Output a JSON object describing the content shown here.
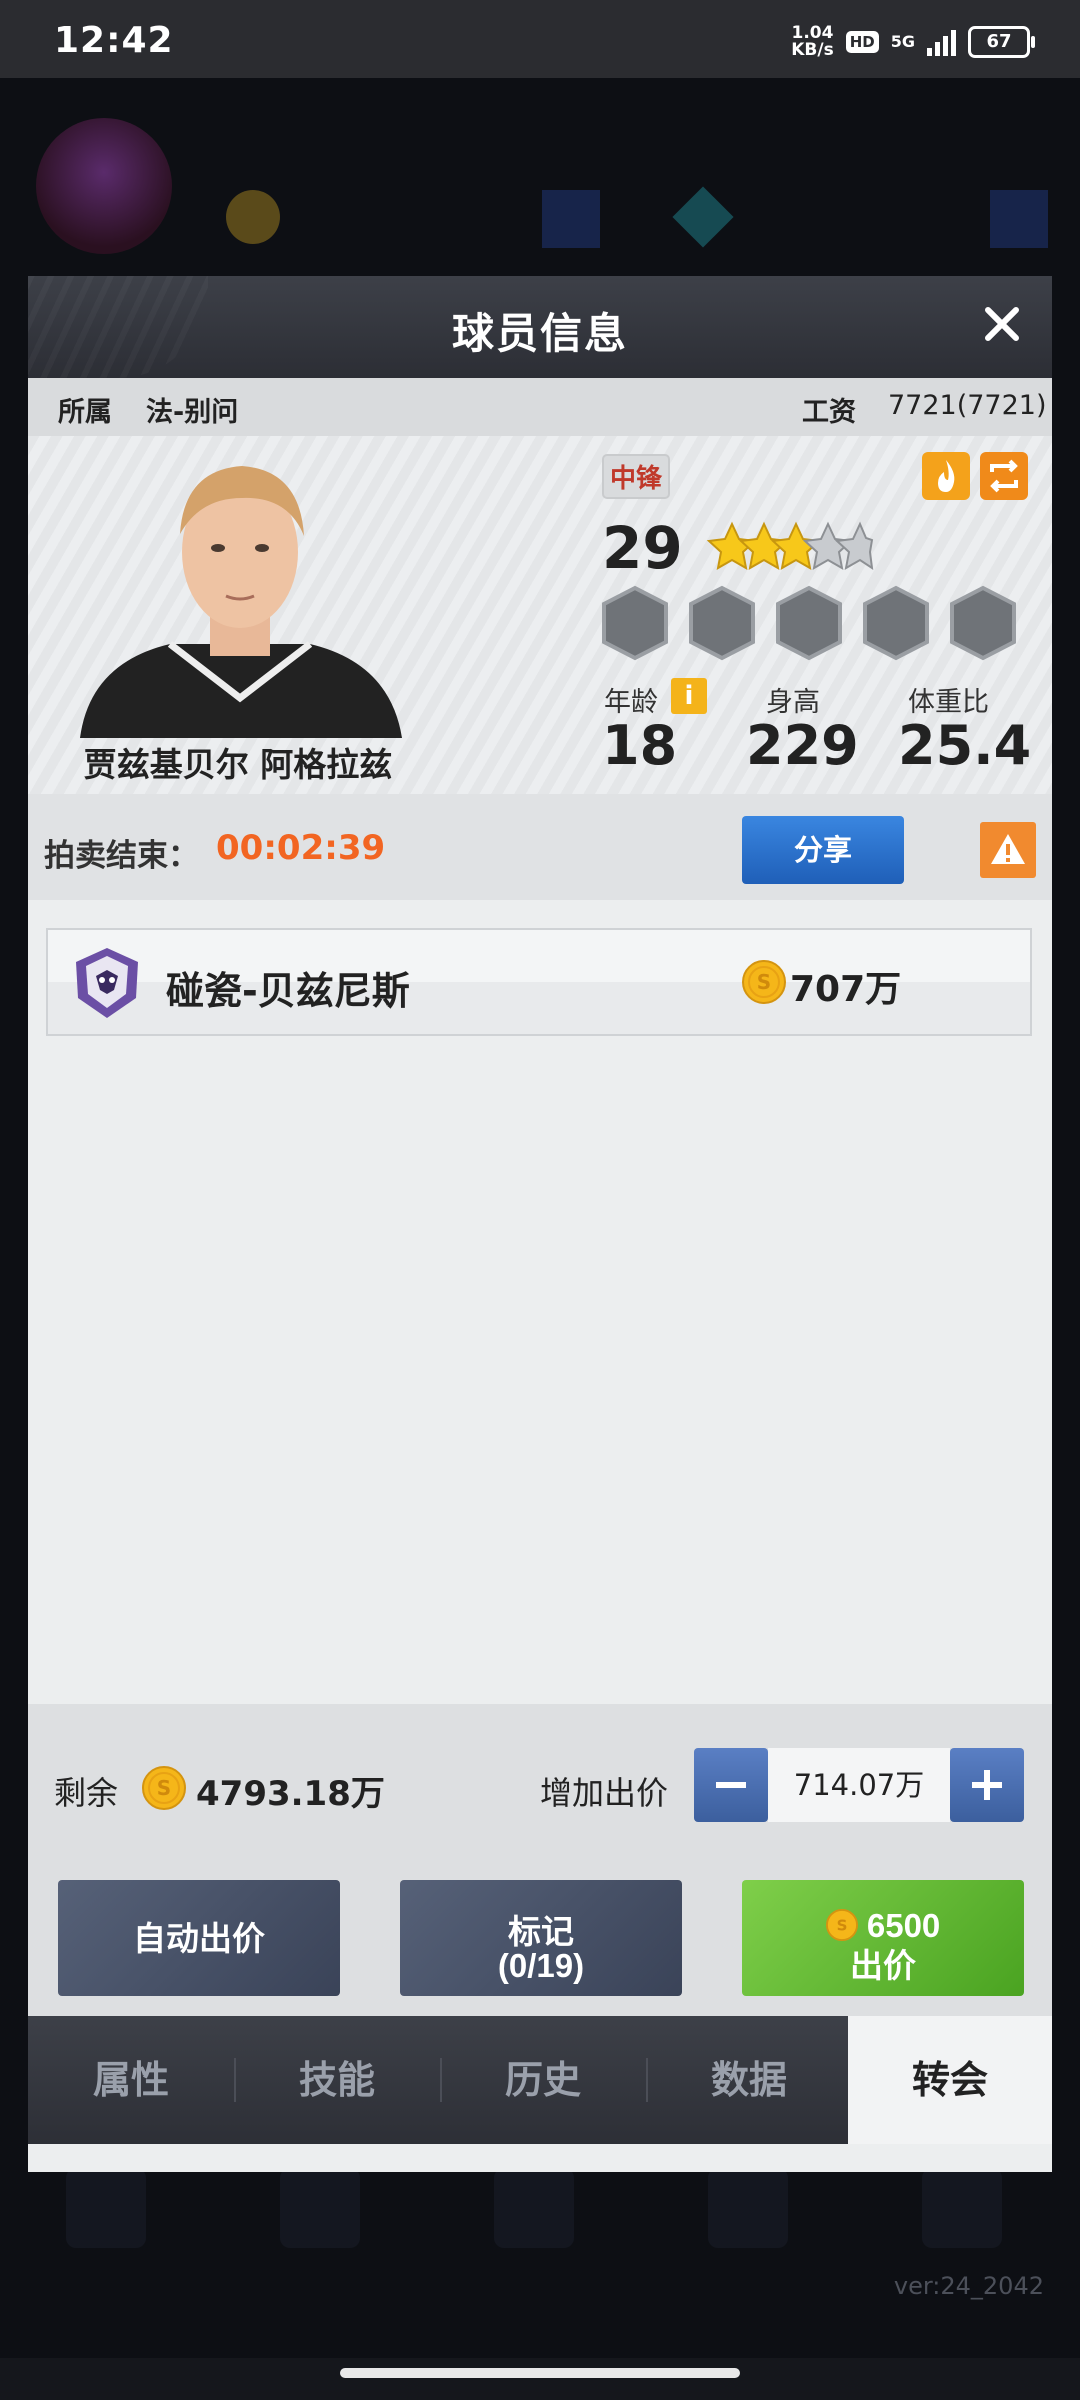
{
  "status_bar": {
    "time": "12:42",
    "net_speed_value": "1.04",
    "net_speed_unit": "KB/s",
    "hd": "HD",
    "network": "5G",
    "battery": "67"
  },
  "background": {
    "version": "ver:24_2042"
  },
  "modal": {
    "title": "球员信息",
    "affiliation_label": "所属",
    "affiliation_value": "法-别问",
    "salary_label": "工资",
    "salary_value": "7721(7721)"
  },
  "player": {
    "name": "贾兹基贝尔 阿格拉兹",
    "position": "中锋",
    "rating": "29",
    "stars": 3,
    "stars_max": 5,
    "skill_slots": 5,
    "age_label": "年龄",
    "age": "18",
    "height_label": "身高",
    "height": "229",
    "weight_ratio_label": "体重比",
    "weight_ratio": "25.4"
  },
  "auction": {
    "end_label": "拍卖结束：",
    "timer": "00:02:39",
    "share_label": "分享"
  },
  "bids": [
    {
      "bidder": "碰瓷-贝兹尼斯",
      "amount": "707万"
    }
  ],
  "bid_panel": {
    "remaining_label": "剩余",
    "remaining_value": "4793.18万",
    "raise_label": "增加出价",
    "raise_value": "714.07万",
    "auto_bid_label": "自动出价",
    "mark_label": "标记",
    "mark_count": "(0/19)",
    "bid_price": "6500",
    "bid_label": "出价"
  },
  "tabs": [
    {
      "label": "属性"
    },
    {
      "label": "技能"
    },
    {
      "label": "历史"
    },
    {
      "label": "数据"
    },
    {
      "label": "转会",
      "active": true
    }
  ],
  "colors": {
    "timer": "#f26522",
    "share_button": "#2a6fcc",
    "bid_button": "#5db52f",
    "coin": "#f5b619"
  }
}
